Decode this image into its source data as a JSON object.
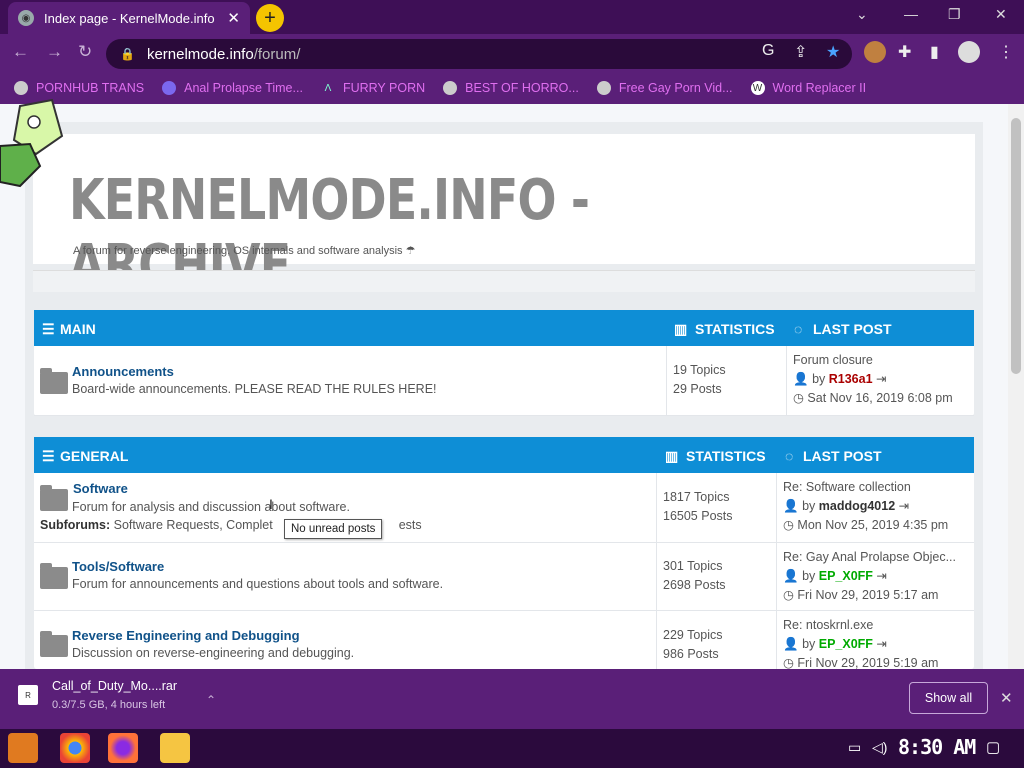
{
  "browser": {
    "tab_title": "Index page - KernelMode.info",
    "url_host": "kernelmode.info",
    "url_path": "/forum/",
    "bookmarks": [
      {
        "label": "PORNHUB TRANS"
      },
      {
        "label": "Anal Prolapse Time..."
      },
      {
        "label": "FURRY PORN"
      },
      {
        "label": "BEST OF HORRO..."
      },
      {
        "label": "Free Gay Porn Vid..."
      },
      {
        "label": "Word Replacer II"
      }
    ]
  },
  "site": {
    "title": "KERNELMODE.INFO - ARCHIVE",
    "description": "A forum for reverse engineering, OS internals and software analysis"
  },
  "sections": [
    {
      "title": "MAIN",
      "stats_header": "STATISTICS",
      "last_header": "LAST POST",
      "forums": [
        {
          "name": "Announcements",
          "desc": "Board-wide announcements. PLEASE READ THE RULES HERE!",
          "topics": "19 Topics",
          "posts": "29 Posts",
          "last_title": "Forum closure",
          "last_by": "by",
          "last_user": "R136a1",
          "last_date": "Sat Nov 16, 2019 6:08 pm"
        }
      ]
    },
    {
      "title": "GENERAL",
      "stats_header": "STATISTICS",
      "last_header": "LAST POST",
      "forums": [
        {
          "name": "Software",
          "desc": "Forum for analysis and discussion about software.",
          "subforums_label": "Subforums:",
          "subforums": "Software Requests, Complet",
          "subforums_tail": "ests",
          "topics": "1817 Topics",
          "posts": "16505 Posts",
          "last_title": "Re: Software collection",
          "last_by": "by",
          "last_user": "maddog4012",
          "last_date": "Mon Nov 25, 2019 4:35 pm"
        },
        {
          "name": "Tools/Software",
          "desc": "Forum for announcements and questions about tools and software.",
          "topics": "301 Topics",
          "posts": "2698 Posts",
          "last_title": "Re: Gay Anal Prolapse Objec...",
          "last_by": "by",
          "last_user": "EP_X0FF",
          "last_date": "Fri Nov 29, 2019 5:17 am"
        },
        {
          "name": "Reverse Engineering and Debugging",
          "desc": "Discussion on reverse-engineering and debugging.",
          "topics": "229 Topics",
          "posts": "986 Posts",
          "last_title": "Re: ntoskrnl.exe",
          "last_by": "by",
          "last_user": "EP_X0FF",
          "last_date": "Fri Nov 29, 2019 5:19 am"
        }
      ]
    }
  ],
  "tooltip": "No unread posts",
  "download": {
    "filename": "Call_of_Duty_Mo....rar",
    "status": "0.3/7.5 GB, 4 hours left",
    "icon_text": "R",
    "show_all": "Show all"
  },
  "taskbar": {
    "time": "8:30 AM"
  },
  "colors": {
    "accent": "#0e8ed6",
    "chrome": "#5a1f78",
    "link": "#105289"
  }
}
